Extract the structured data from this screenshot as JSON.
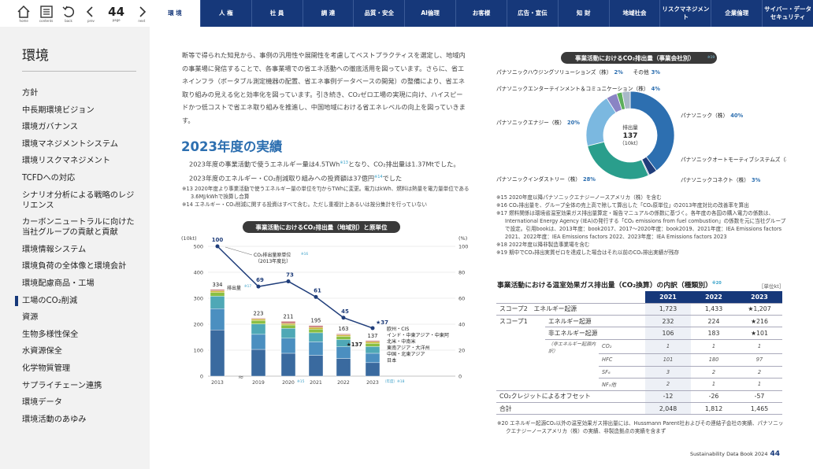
{
  "nav": {
    "home": "home",
    "contents": "contents",
    "back": "back",
    "prev": "prev",
    "page": "page",
    "next": "next",
    "page_number": "44"
  },
  "tabs": [
    "環 境",
    "人 権",
    "社 員",
    "調 達",
    "品質・安全",
    "AI倫理",
    "お客様",
    "広告・宣伝",
    "知 財",
    "地域社会",
    "リスクマネジメント",
    "企業倫理",
    "サイバー・データセキュリティ"
  ],
  "sidebar": {
    "title": "環境",
    "items": [
      "方針",
      "中長期環境ビジョン",
      "環境ガバナンス",
      "環境マネジメントシステム",
      "環境リスクマネジメント",
      "TCFDへの対応",
      "シナリオ分析による戦略のレジリエンス",
      "カーボンニュートラルに向けた当社グループの貢献と貢献",
      "環境情報システム",
      "環境負荷の全体像と環境会計",
      "環境配慮商品・工場",
      "工場のCO₂削減",
      "資源",
      "生物多様性保全",
      "水資源保全",
      "化学物質管理",
      "サプライチェーン連携",
      "環境データ",
      "環境活動のあゆみ"
    ]
  },
  "intro": "断等で得られた知見から、事例の汎用性や展開性を考慮してベストプラクティスを選定し、地域内の事業場に発信することで、各事業場での省エネ活動への徹底活用を図っています。さらに、省エネインフラ（ポータブル測定機器の配置、省エネ事例データベースの開発）の整備により、省エネ取り組みの見える化と効率化を図っています。引き続き、CO₂ゼロ工場の実現に向け、ハイスピードかつ低コストで省エネ取り組みを推進し、中国地域における省エネレベルの向上を図っていきます。",
  "section_heading": "2023年度の実績",
  "body_line1": "2023年度の事業活動で使うエネルギー量は4.5TWh",
  "body_line1_sup": "※13",
  "body_line1b": "となり、CO₂排出量は1.37Mtでした。",
  "body_line2": "2023年度のエネルギー・CO₂削減取り組みへの投資額は37億円",
  "body_line2_sup": "※14",
  "body_line2b": "でした",
  "notes": [
    "※13 2020年度より事業活動で使うエネルギー量の単位をTJからTWhに変更。電力はkWh、燃料は熱量を電力量単位である3.6MJ/kWhで換算し合算",
    "※14 エネルギー・CO₂削減に関する投資はすべて含む。ただし重複計上あるいは按分集計を行っていない"
  ],
  "chart_data": [
    {
      "type": "bar",
      "title": "事業活動におけるCO₂排出量（地域別）と原単位",
      "ylabel_left": "(10kt)",
      "ylabel_right": "(%)",
      "ylim_left": [
        0,
        500
      ],
      "ylim_right": [
        0,
        100
      ],
      "categories": [
        "2013",
        "2019",
        "2020",
        "2021",
        "2022",
        "2023"
      ],
      "category_sups": [
        "",
        "",
        "※15",
        "",
        "",
        "（年度）※18"
      ],
      "totals": [
        334,
        223,
        211,
        195,
        163,
        137
      ],
      "series": [
        {
          "name": "日本",
          "values": [
            178,
            103,
            88,
            80,
            68,
            52
          ]
        },
        {
          "name": "中国・北東アジア",
          "values": [
            82,
            58,
            58,
            52,
            45,
            36
          ]
        },
        {
          "name": "東南アジア・大洋州",
          "values": [
            48,
            40,
            38,
            35,
            28,
            26
          ]
        },
        {
          "name": "北米・中南米",
          "values": [
            14,
            13,
            13,
            14,
            12,
            12
          ]
        },
        {
          "name": "インド・中東アジア・中東阿",
          "values": [
            7,
            6,
            6,
            7,
            6,
            7
          ]
        },
        {
          "name": "欧州・CIS",
          "values": [
            5,
            3,
            8,
            7,
            4,
            4
          ]
        }
      ],
      "line": {
        "name": "CO₂排出量原単位",
        "name_sup": "※16",
        "subtitle": "（2013年度比）",
        "values": [
          100,
          69,
          73,
          61,
          45,
          37
        ]
      },
      "annotation": "排出量",
      "annotation_sup": "※17",
      "star_label": "★37",
      "star_total": "★137"
    },
    {
      "type": "pie",
      "title": "事業活動におけるCO₂排出量（事業会社別）",
      "title_sup": "※19",
      "center_label": "排出量",
      "center_value": "137",
      "center_unit": "（10kt）",
      "slices": [
        {
          "name": "パナソニック（株）",
          "value": 40
        },
        {
          "name": "パナソニックコネクト（株）",
          "value": 3
        },
        {
          "name": "パナソニックオートモーティブシステムズ（株）",
          "value": 0
        },
        {
          "name": "パナソニックインダストリー（株）",
          "value": 28
        },
        {
          "name": "パナソニックエナジー（株）",
          "value": 20
        },
        {
          "name": "パナソニックエンターテインメント＆コミュニケーション（株）",
          "value": 4
        },
        {
          "name": "パナソニックハウジングソリューションズ（株）",
          "value": 2
        },
        {
          "name": "その他",
          "value": 3
        }
      ]
    }
  ],
  "right_notes": [
    "※15 2020年度以降パナソニックエナジーノースアメリカ（株）を含む",
    "※16 CO₂排出量を、グループ全体の売上高で除して算出した「CO₂原単位」の2013年度対比の改善率を算出",
    "※17 燃料関係は環境省温室効果ガス排出量算定・報告マニュアルの係数に基づく。各年度の各国の購入電力の係数は、International Energy Agency (IEA)の発行する「CO₂ emissions from fuel combustion」の係数を元に当社グループで設定。引用bookは、2013年度：book2017、2017～2020年度：book2019、2021年度：IEA Emissions factors 2021、2022年度：IEA Emissions factors 2022、2023年度：IEA Emissions factors 2023",
    "※18 2022年度以降非製造事業場を含む",
    "※19 期中でCO₂排出実質ゼロを達成した場合はそれ以前のCO₂排出実績が残存"
  ],
  "table": {
    "title": "事業活動における温室効果ガス排出量（CO₂換算）の内訳（種類別）",
    "title_sup": "※20",
    "unit": "［単位kt］",
    "years": [
      "2021",
      "2022",
      "2023"
    ],
    "rows": [
      {
        "l1": "スコープ2　エネルギー起源",
        "l2": "",
        "l3": "",
        "v": [
          "1,723",
          "1,433",
          "★1,207"
        ]
      },
      {
        "l1": "スコープ1",
        "l2": "エネルギー起源",
        "l3": "",
        "v": [
          "232",
          "224",
          "★216"
        ]
      },
      {
        "l1": "",
        "l2": "非エネルギー起源",
        "l3": "",
        "v": [
          "106",
          "183",
          "★101"
        ]
      },
      {
        "l1": "",
        "l2": "（非エネルギー起源内訳）",
        "l3": "CO₂",
        "v": [
          "1",
          "1",
          "1"
        ]
      },
      {
        "l1": "",
        "l2": "",
        "l3": "HFC",
        "v": [
          "101",
          "180",
          "97"
        ]
      },
      {
        "l1": "",
        "l2": "",
        "l3": "SF₆",
        "v": [
          "3",
          "2",
          "2"
        ]
      },
      {
        "l1": "",
        "l2": "",
        "l3": "NF₃他",
        "v": [
          "2",
          "1",
          "1"
        ]
      },
      {
        "l1": "CO₂クレジットによるオフセット",
        "l2": "",
        "l3": "",
        "v": [
          "-12",
          "-26",
          "-57"
        ]
      },
      {
        "l1": "合計",
        "l2": "",
        "l3": "",
        "v": [
          "2,048",
          "1,812",
          "1,465"
        ]
      }
    ]
  },
  "bottom_note": "※20 エネルギー起源CO₂以外の温室効果ガス排出量には、Hussmann Parent社およびその連結子会社の実績、パナソニックエナジーノースアメリカ（株）の実績、非製造拠点の実績を含まず",
  "footer": {
    "label": "Sustainability Data Book 2024",
    "page": "44"
  },
  "colors": {
    "navy": "#16387a",
    "accent": "#2d6fb0",
    "japan": "#3a6a9f",
    "china": "#4b8fc0",
    "sea": "#4fa8b6",
    "na": "#8bbf43",
    "india": "#c9b836",
    "eu": "#c97a7a"
  }
}
